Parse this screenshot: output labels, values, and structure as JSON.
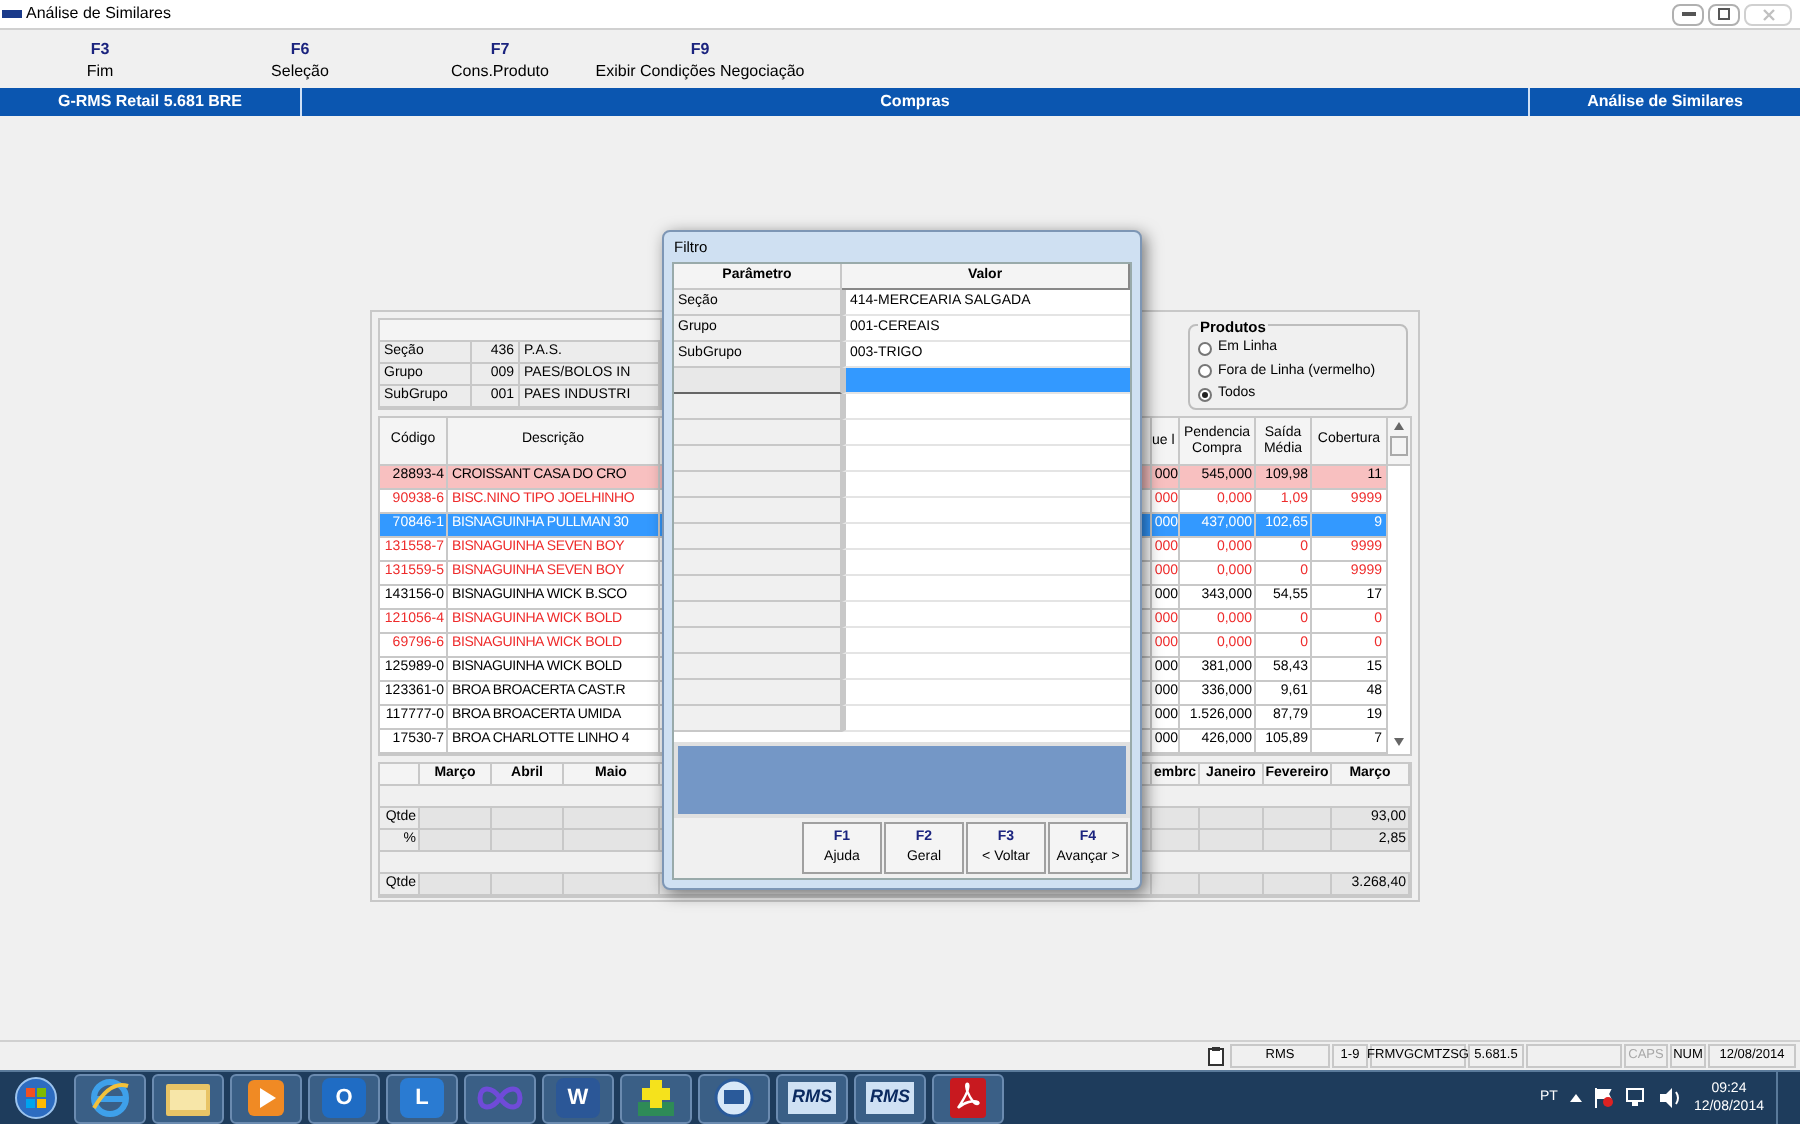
{
  "window": {
    "title": "Análise de Similares"
  },
  "function_keys": [
    {
      "key": "F3",
      "label": "Fim"
    },
    {
      "key": "F6",
      "label": "Seleção"
    },
    {
      "key": "F7",
      "label": "Cons.Produto"
    },
    {
      "key": "F9",
      "label": "Exibir Condições Negociação"
    }
  ],
  "header_bar": {
    "left": "G-RMS Retail 5.681 BRE",
    "center": "Compras",
    "right": "Análise de Similares"
  },
  "info": [
    {
      "label": "Seção",
      "code": "436",
      "name": "P.A.S."
    },
    {
      "label": "Grupo",
      "code": "009",
      "name": "PAES/BOLOS IN"
    },
    {
      "label": "SubGrupo",
      "code": "001",
      "name": "PAES INDUSTRI"
    }
  ],
  "produtos": {
    "title": "Produtos",
    "options": [
      {
        "label": "Em Linha",
        "selected": false
      },
      {
        "label": "Fora de Linha (vermelho)",
        "selected": false
      },
      {
        "label": "Todos",
        "selected": true
      }
    ]
  },
  "grid": {
    "columns": [
      "Código",
      "Descrição",
      "ue l",
      "Pendencia Compra",
      "Saída Média",
      "Cobertura"
    ],
    "rows": [
      {
        "codigo": "28893-4",
        "descricao": "CROISSANT CASA DO CRO",
        "column_3": "000",
        "pendencia": "545,000",
        "saida": "109,98",
        "cobertura": "11",
        "alert": true,
        "inactive": false,
        "selected": false
      },
      {
        "codigo": "90938-6",
        "descricao": "BISC.NINO TIPO JOELHINHO",
        "column_3": "000",
        "pendencia": "0,000",
        "saida": "1,09",
        "cobertura": "9999",
        "alert": false,
        "inactive": true,
        "selected": false
      },
      {
        "codigo": "70846-1",
        "descricao": "BISNAGUINHA PULLMAN 30",
        "column_3": "000",
        "pendencia": "437,000",
        "saida": "102,65",
        "cobertura": "9",
        "alert": false,
        "inactive": false,
        "selected": true
      },
      {
        "codigo": "131558-7",
        "descricao": "BISNAGUINHA SEVEN BOY",
        "column_3": "000",
        "pendencia": "0,000",
        "saida": "0",
        "cobertura": "9999",
        "alert": false,
        "inactive": true,
        "selected": false
      },
      {
        "codigo": "131559-5",
        "descricao": "BISNAGUINHA SEVEN BOY",
        "column_3": "000",
        "pendencia": "0,000",
        "saida": "0",
        "cobertura": "9999",
        "alert": false,
        "inactive": true,
        "selected": false
      },
      {
        "codigo": "143156-0",
        "descricao": "BISNAGUINHA WICK B.SCO",
        "column_3": "000",
        "pendencia": "343,000",
        "saida": "54,55",
        "cobertura": "17",
        "alert": false,
        "inactive": false,
        "selected": false
      },
      {
        "codigo": "121056-4",
        "descricao": "BISNAGUINHA WICK BOLD",
        "column_3": "000",
        "pendencia": "0,000",
        "saida": "0",
        "cobertura": "0",
        "alert": false,
        "inactive": true,
        "selected": false
      },
      {
        "codigo": "69796-6",
        "descricao": "BISNAGUINHA WICK BOLD",
        "column_3": "000",
        "pendencia": "0,000",
        "saida": "0",
        "cobertura": "0",
        "alert": false,
        "inactive": true,
        "selected": false
      },
      {
        "codigo": "125989-0",
        "descricao": "BISNAGUINHA WICK BOLD",
        "column_3": "000",
        "pendencia": "381,000",
        "saida": "58,43",
        "cobertura": "15",
        "alert": false,
        "inactive": false,
        "selected": false
      },
      {
        "codigo": "123361-0",
        "descricao": "BROA BROACERTA CAST.R",
        "column_3": "000",
        "pendencia": "336,000",
        "saida": "9,61",
        "cobertura": "48",
        "alert": false,
        "inactive": false,
        "selected": false
      },
      {
        "codigo": "117777-0",
        "descricao": "BROA BROACERTA UMIDA",
        "column_3": "000",
        "pendencia": "1.526,000",
        "saida": "87,79",
        "cobertura": "19",
        "alert": false,
        "inactive": false,
        "selected": false
      },
      {
        "codigo": "17530-7",
        "descricao": "BROA CHARLOTTE LINHO 4",
        "column_3": "000",
        "pendencia": "426,000",
        "saida": "105,89",
        "cobertura": "7",
        "alert": false,
        "inactive": false,
        "selected": false
      }
    ]
  },
  "months": {
    "left": [
      "Março",
      "Abril",
      "Maio"
    ],
    "right": [
      "embrc",
      "Janeiro",
      "Fevereiro",
      "Março"
    ],
    "rows": [
      {
        "kind": "blank"
      },
      {
        "kind": "data",
        "label": "Qtde",
        "marco": "93,00"
      },
      {
        "kind": "data",
        "label": "%",
        "marco": "2,85"
      },
      {
        "kind": "blank"
      },
      {
        "kind": "data",
        "label": "Qtde",
        "marco": "3.268,40"
      }
    ]
  },
  "dialog": {
    "title": "Filtro",
    "columns": [
      "Parâmetro",
      "Valor"
    ],
    "rows": [
      {
        "parametro": "Seção",
        "valor": "414-MERCEARIA SALGADA",
        "selected": false
      },
      {
        "parametro": "Grupo",
        "valor": "001-CEREAIS",
        "selected": false
      },
      {
        "parametro": "SubGrupo",
        "valor": "003-TRIGO",
        "selected": false
      },
      {
        "selected": true
      },
      {
        "selected": false
      },
      {
        "selected": false
      },
      {
        "selected": false
      },
      {
        "selected": false
      },
      {
        "selected": false
      },
      {
        "selected": false
      },
      {
        "selected": false
      },
      {
        "selected": false
      },
      {
        "selected": false
      },
      {
        "selected": false
      },
      {
        "selected": false
      },
      {
        "selected": false
      },
      {
        "selected": false
      }
    ],
    "buttons": [
      {
        "key": "F1",
        "label": "Ajuda"
      },
      {
        "key": "F2",
        "label": "Geral"
      },
      {
        "key": "F3",
        "label": "< Voltar"
      },
      {
        "key": "F4",
        "label": "Avançar >"
      }
    ]
  },
  "status_bar": {
    "fields": [
      {
        "text": "RMS",
        "disabled": false
      },
      {
        "text": "1-9",
        "disabled": false
      },
      {
        "text": "FRMVGCMTZSG",
        "disabled": false
      },
      {
        "text": "5.681.5",
        "disabled": false
      },
      {
        "text": "CAPS",
        "disabled": true
      },
      {
        "text": "NUM",
        "disabled": false
      },
      {
        "text": "12/08/2014",
        "disabled": false
      }
    ]
  },
  "taskbar": {
    "apps": [
      {
        "kind": "browser"
      },
      {
        "kind": "folder"
      },
      {
        "kind": "media"
      },
      {
        "kind": "mail",
        "label": "O"
      },
      {
        "kind": "chat",
        "label": "L"
      },
      {
        "kind": "infinity"
      },
      {
        "kind": "doc",
        "label": "W"
      },
      {
        "kind": "plus"
      },
      {
        "kind": "network"
      },
      {
        "kind": "rms",
        "label": "RMS"
      },
      {
        "kind": "rms",
        "label": "RMS"
      },
      {
        "kind": "pdf"
      }
    ],
    "language": "PT",
    "time": "09:24",
    "date": "12/08/2014"
  }
}
